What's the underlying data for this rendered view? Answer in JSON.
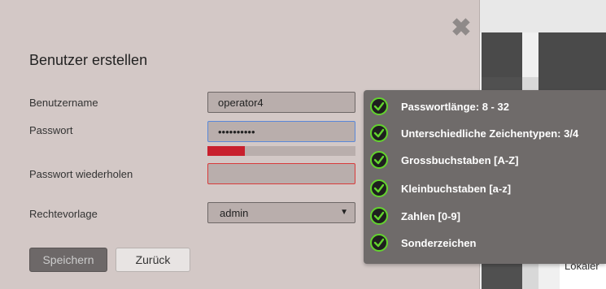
{
  "background": {
    "partial_label": "Lokaler"
  },
  "modal": {
    "title": "Benutzer erstellen",
    "close_icon": "close-icon",
    "fields": {
      "username": {
        "label": "Benutzername",
        "value": "operator4"
      },
      "password": {
        "label": "Passwort",
        "value": "••••••••••"
      },
      "password_repeat": {
        "label": "Passwort wiederholen",
        "value": ""
      },
      "role": {
        "label": "Rechtevorlage",
        "value": "admin"
      }
    },
    "password_strength": 0.25,
    "buttons": {
      "save": "Speichern",
      "back": "Zurück"
    }
  },
  "tooltip": {
    "rules": [
      {
        "text": "Passwortlänge: 8 - 32",
        "icon": "check-icon"
      },
      {
        "text": "Unterschiedliche Zeichentypen: 3/4",
        "icon": "check-icon"
      },
      {
        "text": "Grossbuchstaben [A-Z]",
        "icon": "check-icon"
      },
      {
        "text": "Kleinbuchstaben [a-z]",
        "icon": "check-icon"
      },
      {
        "text": "Zahlen [0-9]",
        "icon": "check-icon"
      },
      {
        "text": "Sonderzeichen",
        "icon": "check-icon"
      }
    ]
  },
  "colors": {
    "check_green": "#63d32e",
    "strength_red": "#c8202d",
    "focus_blue": "#5a88d8",
    "error_red": "#d83a3a"
  }
}
